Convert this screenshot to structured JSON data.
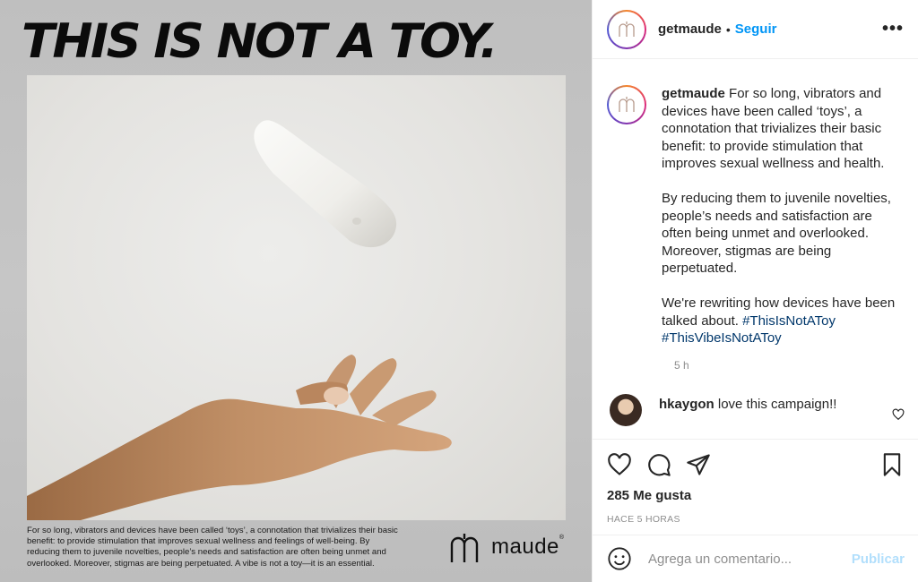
{
  "post_image": {
    "headline": "THIS IS NOT A TOY.",
    "caption_text": "For so long, vibrators and devices have been called ‘toys’, a connotation that trivializes their basic benefit: to provide stimulation that improves sexual wellness and feelings of well-being. By reducing them to juvenile novelties, people’s needs and satisfaction are often being unmet and overlooked. Moreover, stigmas are being perpetuated. A vibe is not a toy—it is an essential.",
    "brand_name": "maude",
    "brand_mark_icon": "maude-logo-icon"
  },
  "header": {
    "username": "getmaude",
    "separator": "•",
    "follow_label": "Seguir",
    "more_icon": "more-options-icon",
    "more_label": "•••"
  },
  "caption": {
    "username": "getmaude",
    "paragraph1": "For so long, vibrators and devices have been called ‘toys’, a connotation that trivializes their basic benefit: to provide stimulation that improves sexual wellness and health.",
    "paragraph2": "By reducing them to juvenile novelties, people’s needs and satisfaction are often being unmet and overlooked. Moreover, stigmas are being perpetuated.",
    "paragraph3": "We're rewriting how devices have been talked about.",
    "hashtag1": "#ThisIsNotAToy",
    "hashtag2": "#ThisVibeIsNotAToy",
    "time": "5 h"
  },
  "comments": [
    {
      "username": "hkaygon",
      "text": "love this campaign!!"
    }
  ],
  "actions": {
    "likes": "285 Me gusta",
    "timestamp": "HACE 5 HORAS",
    "icons": [
      "heart-icon",
      "comment-icon",
      "share-icon",
      "bookmark-icon"
    ]
  },
  "comment_box": {
    "placeholder": "Agrega un comentario...",
    "publish_label": "Publicar",
    "emoji_icon": "emoji-icon"
  },
  "colors": {
    "link_blue": "#0095f6",
    "hashtag_blue": "#00376b",
    "publish_disabled": "#b2dffc",
    "muted": "#8e8e8e"
  }
}
